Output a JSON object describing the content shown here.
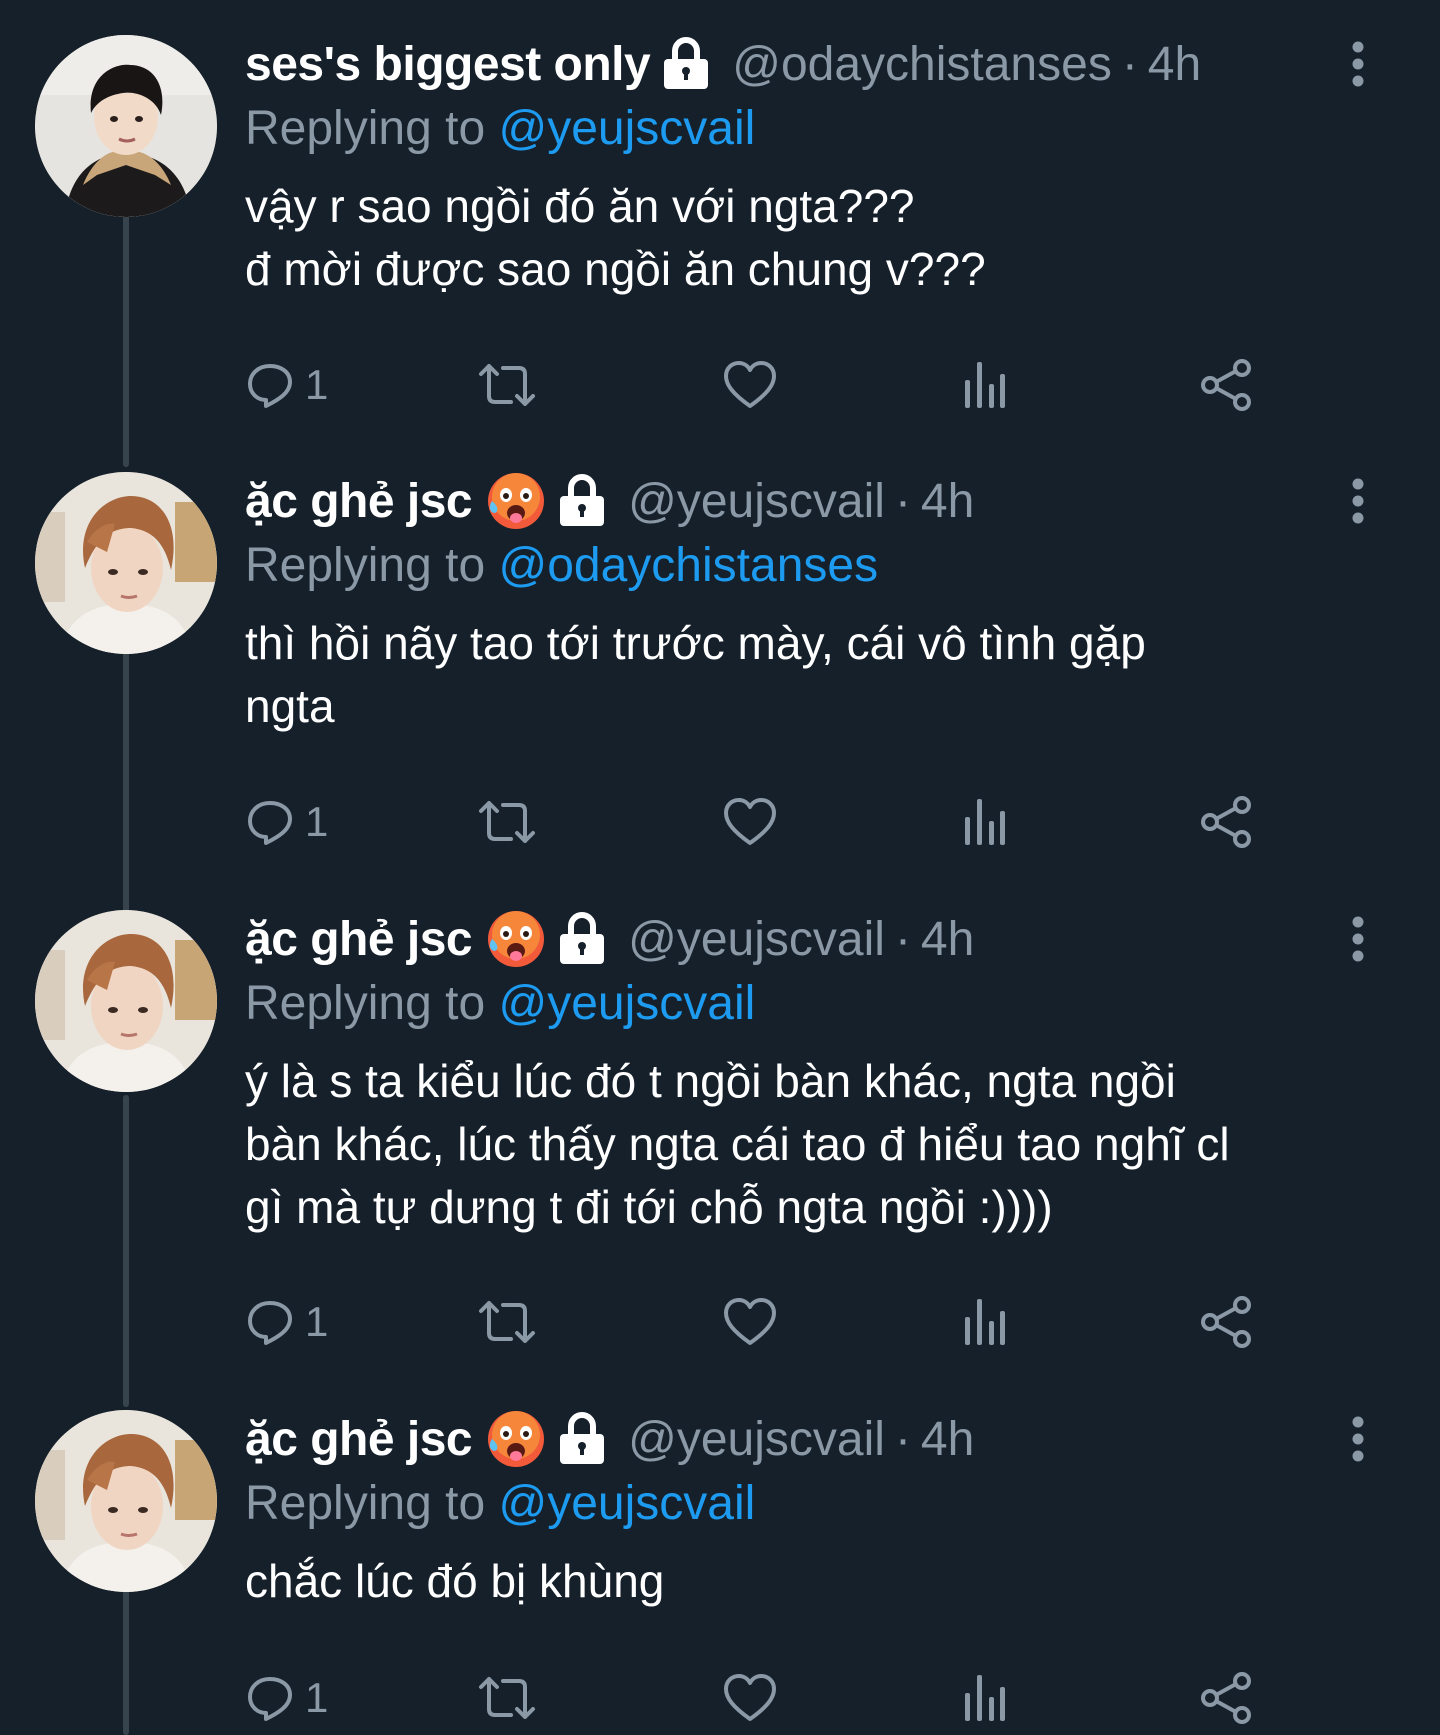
{
  "tweets": [
    {
      "display_name": "ses's biggest only",
      "has_emoji": false,
      "handle": "@odaychistanses",
      "separator": "·",
      "time": "4h",
      "replying_label": "Replying to",
      "replying_to": "@yeujscvail",
      "text": "vậy r sao ngồi đó ăn với ngta???\nđ mời được sao ngồi ăn chung v???",
      "reply_count": "1",
      "avatar": "user-odaychistanses"
    },
    {
      "display_name": "ặc ghẻ jsc",
      "has_emoji": true,
      "emoji": "hot-face-emoji",
      "handle": "@yeujscvail",
      "separator": "·",
      "time": "4h",
      "replying_label": "Replying to",
      "replying_to": "@odaychistanses",
      "text": "thì hồi nãy tao tới trước mày, cái vô tình gặp\nngta",
      "reply_count": "1",
      "avatar": "user-yeujscvail"
    },
    {
      "display_name": "ặc ghẻ jsc",
      "has_emoji": true,
      "emoji": "hot-face-emoji",
      "handle": "@yeujscvail",
      "separator": "·",
      "time": "4h",
      "replying_label": "Replying to",
      "replying_to": "@yeujscvail",
      "text": "ý là s ta kiểu lúc đó t ngồi bàn khác, ngta ngồi\nbàn khác, lúc thấy ngta cái tao đ hiểu tao nghĩ cl\ngì mà tự dưng t đi tới chỗ ngta ngồi :))))",
      "reply_count": "1",
      "avatar": "user-yeujscvail"
    },
    {
      "display_name": "ặc ghẻ jsc",
      "has_emoji": true,
      "emoji": "hot-face-emoji",
      "handle": "@yeujscvail",
      "separator": "·",
      "time": "4h",
      "replying_label": "Replying to",
      "replying_to": "@yeujscvail",
      "text": "chắc lúc đó bị khùng",
      "reply_count": "1",
      "avatar": "user-yeujscvail"
    }
  ],
  "icons": {
    "reply": "reply-icon",
    "retweet": "retweet-icon",
    "like": "heart-icon",
    "views": "views-icon",
    "share": "share-icon",
    "more": "more-vertical-icon",
    "protected": "lock-icon"
  },
  "colors": {
    "background": "#15202b",
    "text": "#ffffff",
    "secondary": "#8b98a5",
    "link": "#1d9bf0",
    "thread_line": "#38444d"
  }
}
